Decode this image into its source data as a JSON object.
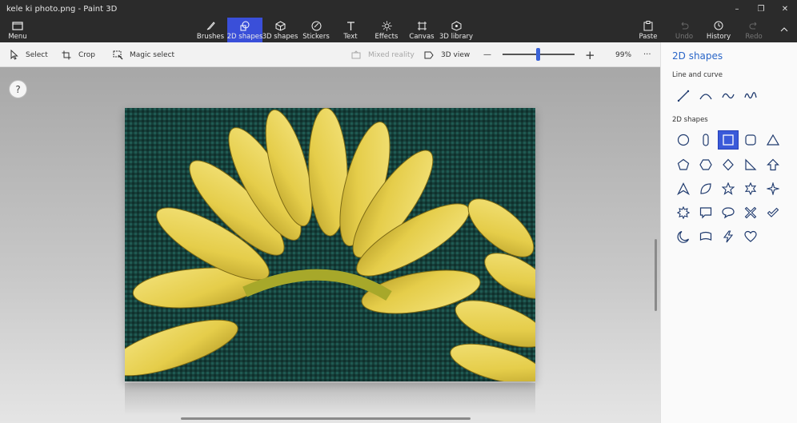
{
  "window": {
    "title": "kele ki photo.png - Paint 3D",
    "minimize": "–",
    "restore": "❐",
    "close": "✕"
  },
  "ribbon": {
    "menu": "Menu",
    "tools": [
      {
        "label": "Brushes",
        "icon": "brush-icon"
      },
      {
        "label": "2D shapes",
        "icon": "2d-shapes-icon"
      },
      {
        "label": "3D shapes",
        "icon": "3d-shapes-icon"
      },
      {
        "label": "Stickers",
        "icon": "sticker-icon"
      },
      {
        "label": "Text",
        "icon": "text-icon"
      },
      {
        "label": "Effects",
        "icon": "effects-icon"
      },
      {
        "label": "Canvas",
        "icon": "canvas-icon"
      },
      {
        "label": "3D library",
        "icon": "3d-library-icon"
      }
    ],
    "active_tool": "2D shapes",
    "paste": "Paste",
    "undo": "Undo",
    "history": "History",
    "redo": "Redo",
    "accent": "#3a4fd9"
  },
  "toolbar": {
    "select": "Select",
    "crop": "Crop",
    "magic_select": "Magic select",
    "mixed_reality": "Mixed reality",
    "view_3d": "3D view",
    "zoom_out": "—",
    "zoom_in": "+",
    "zoom_level": "99%",
    "zoom_fraction": 0.5,
    "more": "···"
  },
  "canvas": {
    "help": "?"
  },
  "panel": {
    "title": "2D shapes",
    "line_section": "Line and curve",
    "shapes_section": "2D shapes",
    "lines": [
      "line-icon",
      "curve-icon",
      "two-point-curve-icon",
      "three-point-curve-icon"
    ],
    "shapes": [
      [
        "circle-icon",
        "pill-icon",
        "square-icon",
        "rounded-square-icon",
        "triangle-icon"
      ],
      [
        "pentagon-icon",
        "hexagon-icon",
        "diamond-icon",
        "right-triangle-icon",
        "arrow-up-icon"
      ],
      [
        "triangle-outline-icon",
        "leaf-icon",
        "star-5-icon",
        "star-6-icon",
        "star-4-icon"
      ],
      [
        "burst-icon",
        "speech-rect-icon",
        "speech-oval-icon",
        "cross-icon",
        "check-icon"
      ],
      [
        "moon-icon",
        "banner-icon",
        "lightning-icon",
        "heart-icon"
      ]
    ],
    "selected_shape": "square-icon"
  }
}
